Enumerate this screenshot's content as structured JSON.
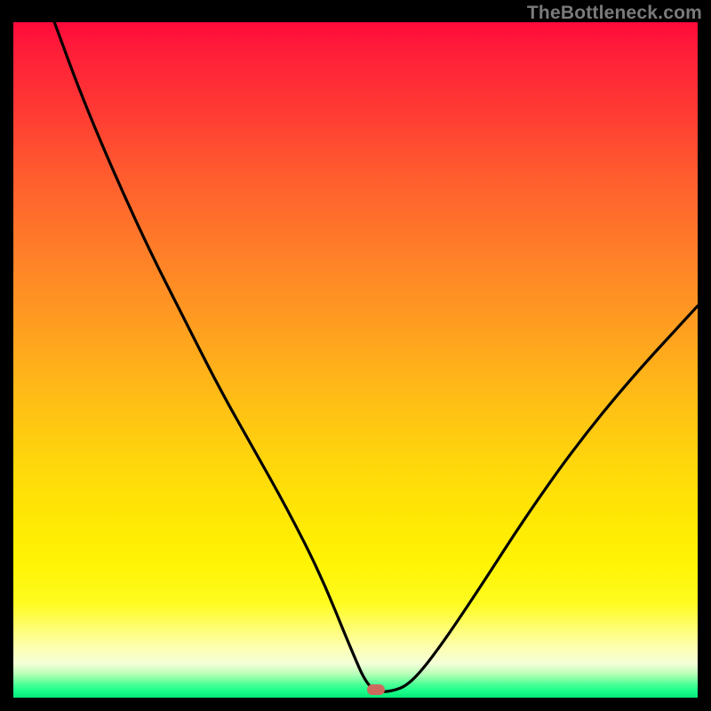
{
  "watermark": "TheBottleneck.com",
  "marker": {
    "color": "#cd6a5e",
    "x_pct": 53.0,
    "y_pct": 98.8
  },
  "chart_data": {
    "type": "line",
    "title": "",
    "xlabel": "",
    "ylabel": "",
    "xlim": [
      0,
      100
    ],
    "ylim": [
      0,
      100
    ],
    "grid": false,
    "legend": false,
    "notes": "No axis ticks or labels are shown. Vertical color gradient from red (top) through orange and yellow to green (bottom) encodes the scale. Curve is a V-shape reaching ~0 near x≈53.",
    "series": [
      {
        "name": "bottleneck-curve",
        "x": [
          6,
          10,
          15,
          20,
          25,
          30,
          35,
          40,
          45,
          49,
          52,
          55,
          58,
          62,
          68,
          75,
          82,
          90,
          100
        ],
        "y": [
          100,
          89,
          77,
          66,
          56,
          46,
          37,
          28,
          18,
          8,
          1,
          0.8,
          2,
          7,
          16,
          27,
          37,
          47,
          58
        ]
      }
    ],
    "marker_point": {
      "x": 53,
      "y": 1.2
    }
  }
}
